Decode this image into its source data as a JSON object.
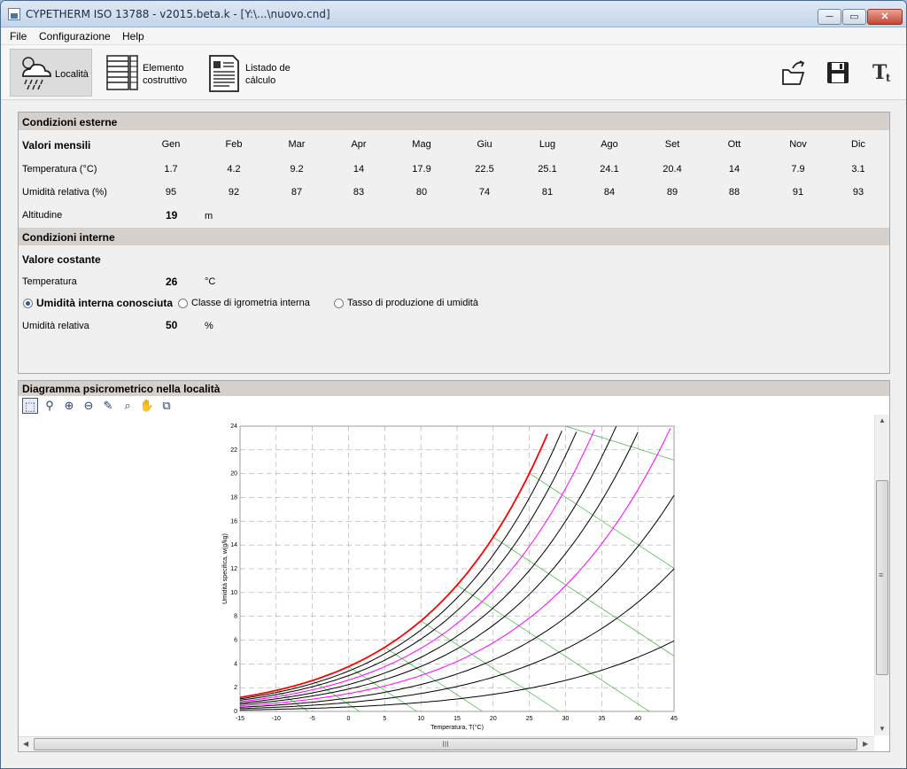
{
  "window": {
    "title": "CYPETHERM ISO 13788 - v2015.beta.k - [Y:\\...\\nuovo.cnd]",
    "min": "─",
    "max": "▭",
    "close": "✕"
  },
  "menu": [
    "File",
    "Configurazione",
    "Help"
  ],
  "toolbar": {
    "localita": "Località",
    "elemento_1": "Elemento",
    "elemento_2": "costruttivo",
    "listado_1": "Listado de",
    "listado_2": "cálculo"
  },
  "external": {
    "header": "Condizioni esterne",
    "row_months_label": "Valori mensili",
    "months": [
      "Gen",
      "Feb",
      "Mar",
      "Apr",
      "Mag",
      "Giu",
      "Lug",
      "Ago",
      "Set",
      "Ott",
      "Nov",
      "Dic"
    ],
    "temp_label": "Temperatura (°C)",
    "temps": [
      "1.7",
      "4.2",
      "9.2",
      "14",
      "17.9",
      "22.5",
      "25.1",
      "24.1",
      "20.4",
      "14",
      "7.9",
      "3.1"
    ],
    "hum_label": "Umidità relativa (%)",
    "hums": [
      "95",
      "92",
      "87",
      "83",
      "80",
      "74",
      "81",
      "84",
      "89",
      "88",
      "91",
      "93"
    ],
    "alt_label": "Altitudine",
    "alt_value": "19",
    "alt_unit": "m"
  },
  "internal": {
    "header": "Condizioni interne",
    "const_label": "Valore costante",
    "temp_label": "Temperatura",
    "temp_value": "26",
    "temp_unit": "°C",
    "radio_1": "Umidità interna conosciuta",
    "radio_2": "Classe di igrometria interna",
    "radio_3": "Tasso di produzione di umidità",
    "hum_label": "Umidità relativa",
    "hum_value": "50",
    "hum_unit": "%"
  },
  "psy": {
    "header": "Diagramma psicrometrico nella località",
    "tools": [
      "zoom-window-icon",
      "zoom-dynamic-icon",
      "zoom-all-icon",
      "zoom-previous-icon",
      "edit-icon",
      "zoom-object-icon",
      "pan-hand-icon",
      "copy-icon"
    ],
    "hscroll_grip": "III",
    "vscroll_grip": "≡"
  },
  "chart_data": {
    "type": "line",
    "xlabel": "Temperatura, T(°C)",
    "ylabel": "Umidità specifica, w(g/kg)",
    "xlim": [
      -15,
      45
    ],
    "ylim": [
      0,
      24
    ],
    "x_ticks": [
      -15,
      -10,
      -5,
      0,
      5,
      10,
      15,
      20,
      25,
      30,
      35,
      40,
      45
    ],
    "y_ticks": [
      0,
      2,
      4,
      6,
      8,
      10,
      12,
      14,
      16,
      18,
      20,
      22,
      24
    ],
    "grid": true,
    "series": [
      {
        "rh": 100,
        "color": "#ff0000"
      },
      {
        "rh": 90,
        "color": "#000000"
      },
      {
        "rh": 80,
        "color": "#000000"
      },
      {
        "rh": 70,
        "color": "#ff00ff"
      },
      {
        "rh": 60,
        "color": "#000000"
      },
      {
        "rh": 50,
        "color": "#000000"
      },
      {
        "rh": 40,
        "color": "#ff00ff"
      },
      {
        "rh": 30,
        "color": "#000000"
      },
      {
        "rh": 20,
        "color": "#000000"
      },
      {
        "rh": 10,
        "color": "#000000"
      }
    ],
    "wet_bulb_color": "#3cb43c"
  }
}
